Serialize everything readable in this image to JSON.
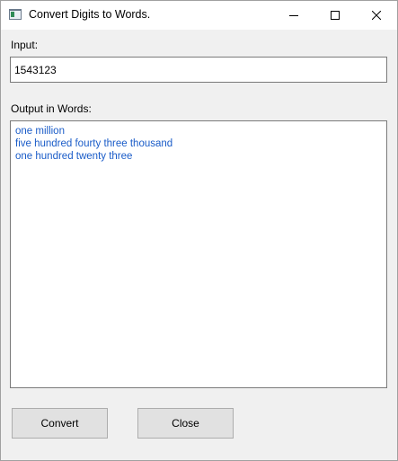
{
  "window": {
    "title": "Convert Digits to Words.",
    "controls": {
      "minimize": "minimize-icon",
      "maximize": "maximize-icon",
      "close": "close-icon"
    }
  },
  "input": {
    "label": "Input:",
    "value": "1543123"
  },
  "output": {
    "label": "Output in Words:",
    "lines": [
      "one million",
      "five hundred fourty three thousand",
      "one hundred twenty three"
    ]
  },
  "buttons": {
    "convert": "Convert",
    "close": "Close"
  },
  "colors": {
    "output_text": "#1a5cc8",
    "window_bg": "#f0f0f0"
  }
}
